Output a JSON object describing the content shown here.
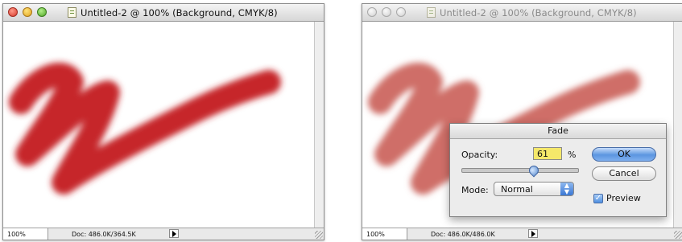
{
  "window_left": {
    "title": "Untitled-2 @ 100% (Background, CMYK/8)",
    "zoom": "100%",
    "doc_info": "Doc: 486.0K/364.5K"
  },
  "window_right": {
    "title": "Untitled-2 @ 100% (Background, CMYK/8)",
    "zoom": "100%",
    "doc_info": "Doc: 486.0K/486.0K"
  },
  "fade_dialog": {
    "title": "Fade",
    "opacity_label": "Opacity:",
    "opacity_value": "61",
    "percent_sign": "%",
    "opacity_fraction": 0.61,
    "mode_label": "Mode:",
    "mode_value": "Normal",
    "ok_label": "OK",
    "cancel_label": "Cancel",
    "preview_label": "Preview",
    "preview_checked": true
  },
  "colors": {
    "stroke_full": "#c6262a",
    "stroke_faded": "#cf6e67",
    "accent": "#5b95e0"
  }
}
